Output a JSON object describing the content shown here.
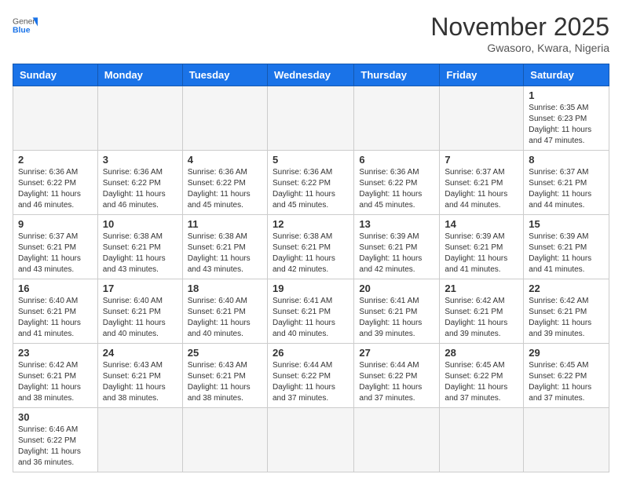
{
  "header": {
    "logo_general": "General",
    "logo_blue": "Blue",
    "month_title": "November 2025",
    "location": "Gwasoro, Kwara, Nigeria"
  },
  "weekdays": [
    "Sunday",
    "Monday",
    "Tuesday",
    "Wednesday",
    "Thursday",
    "Friday",
    "Saturday"
  ],
  "days": {
    "d1": {
      "num": "1",
      "sunrise": "6:35 AM",
      "sunset": "6:23 PM",
      "daylight": "11 hours and 47 minutes."
    },
    "d2": {
      "num": "2",
      "sunrise": "6:36 AM",
      "sunset": "6:22 PM",
      "daylight": "11 hours and 46 minutes."
    },
    "d3": {
      "num": "3",
      "sunrise": "6:36 AM",
      "sunset": "6:22 PM",
      "daylight": "11 hours and 46 minutes."
    },
    "d4": {
      "num": "4",
      "sunrise": "6:36 AM",
      "sunset": "6:22 PM",
      "daylight": "11 hours and 45 minutes."
    },
    "d5": {
      "num": "5",
      "sunrise": "6:36 AM",
      "sunset": "6:22 PM",
      "daylight": "11 hours and 45 minutes."
    },
    "d6": {
      "num": "6",
      "sunrise": "6:36 AM",
      "sunset": "6:22 PM",
      "daylight": "11 hours and 45 minutes."
    },
    "d7": {
      "num": "7",
      "sunrise": "6:37 AM",
      "sunset": "6:21 PM",
      "daylight": "11 hours and 44 minutes."
    },
    "d8": {
      "num": "8",
      "sunrise": "6:37 AM",
      "sunset": "6:21 PM",
      "daylight": "11 hours and 44 minutes."
    },
    "d9": {
      "num": "9",
      "sunrise": "6:37 AM",
      "sunset": "6:21 PM",
      "daylight": "11 hours and 43 minutes."
    },
    "d10": {
      "num": "10",
      "sunrise": "6:38 AM",
      "sunset": "6:21 PM",
      "daylight": "11 hours and 43 minutes."
    },
    "d11": {
      "num": "11",
      "sunrise": "6:38 AM",
      "sunset": "6:21 PM",
      "daylight": "11 hours and 43 minutes."
    },
    "d12": {
      "num": "12",
      "sunrise": "6:38 AM",
      "sunset": "6:21 PM",
      "daylight": "11 hours and 42 minutes."
    },
    "d13": {
      "num": "13",
      "sunrise": "6:39 AM",
      "sunset": "6:21 PM",
      "daylight": "11 hours and 42 minutes."
    },
    "d14": {
      "num": "14",
      "sunrise": "6:39 AM",
      "sunset": "6:21 PM",
      "daylight": "11 hours and 41 minutes."
    },
    "d15": {
      "num": "15",
      "sunrise": "6:39 AM",
      "sunset": "6:21 PM",
      "daylight": "11 hours and 41 minutes."
    },
    "d16": {
      "num": "16",
      "sunrise": "6:40 AM",
      "sunset": "6:21 PM",
      "daylight": "11 hours and 41 minutes."
    },
    "d17": {
      "num": "17",
      "sunrise": "6:40 AM",
      "sunset": "6:21 PM",
      "daylight": "11 hours and 40 minutes."
    },
    "d18": {
      "num": "18",
      "sunrise": "6:40 AM",
      "sunset": "6:21 PM",
      "daylight": "11 hours and 40 minutes."
    },
    "d19": {
      "num": "19",
      "sunrise": "6:41 AM",
      "sunset": "6:21 PM",
      "daylight": "11 hours and 40 minutes."
    },
    "d20": {
      "num": "20",
      "sunrise": "6:41 AM",
      "sunset": "6:21 PM",
      "daylight": "11 hours and 39 minutes."
    },
    "d21": {
      "num": "21",
      "sunrise": "6:42 AM",
      "sunset": "6:21 PM",
      "daylight": "11 hours and 39 minutes."
    },
    "d22": {
      "num": "22",
      "sunrise": "6:42 AM",
      "sunset": "6:21 PM",
      "daylight": "11 hours and 39 minutes."
    },
    "d23": {
      "num": "23",
      "sunrise": "6:42 AM",
      "sunset": "6:21 PM",
      "daylight": "11 hours and 38 minutes."
    },
    "d24": {
      "num": "24",
      "sunrise": "6:43 AM",
      "sunset": "6:21 PM",
      "daylight": "11 hours and 38 minutes."
    },
    "d25": {
      "num": "25",
      "sunrise": "6:43 AM",
      "sunset": "6:21 PM",
      "daylight": "11 hours and 38 minutes."
    },
    "d26": {
      "num": "26",
      "sunrise": "6:44 AM",
      "sunset": "6:22 PM",
      "daylight": "11 hours and 37 minutes."
    },
    "d27": {
      "num": "27",
      "sunrise": "6:44 AM",
      "sunset": "6:22 PM",
      "daylight": "11 hours and 37 minutes."
    },
    "d28": {
      "num": "28",
      "sunrise": "6:45 AM",
      "sunset": "6:22 PM",
      "daylight": "11 hours and 37 minutes."
    },
    "d29": {
      "num": "29",
      "sunrise": "6:45 AM",
      "sunset": "6:22 PM",
      "daylight": "11 hours and 37 minutes."
    },
    "d30": {
      "num": "30",
      "sunrise": "6:46 AM",
      "sunset": "6:22 PM",
      "daylight": "11 hours and 36 minutes."
    }
  },
  "labels": {
    "sunrise": "Sunrise:",
    "sunset": "Sunset:",
    "daylight": "Daylight:"
  }
}
